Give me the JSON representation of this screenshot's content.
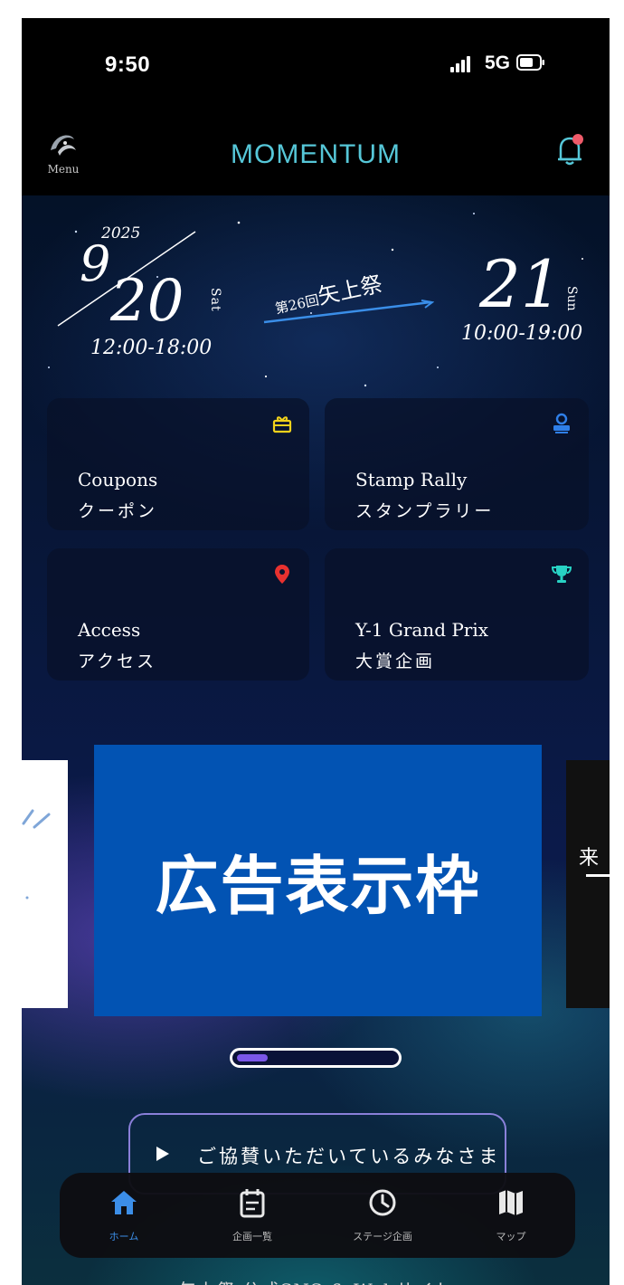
{
  "status_bar": {
    "time": "9:50",
    "network": "5G"
  },
  "header": {
    "menu_label": "Menu",
    "brand": "MOMENTUM"
  },
  "festival": {
    "year": "2025",
    "month": "9",
    "day1": "20",
    "weekday1": "Sat",
    "hours1": "12:00-18:00",
    "edition": "第26回",
    "name": "矢上祭",
    "day2": "21",
    "weekday2": "Sun",
    "hours2": "10:00-19:00"
  },
  "tiles": [
    {
      "en": "Coupons",
      "ja": "クーポン",
      "icon": "gift-icon",
      "color": "#f2d21b"
    },
    {
      "en": "Stamp Rally",
      "ja": "スタンプラリー",
      "icon": "stamp-icon",
      "color": "#2f7fe8"
    },
    {
      "en": "Access",
      "ja": "アクセス",
      "icon": "map-pin-icon",
      "color": "#e8312f"
    },
    {
      "en": "Y-1 Grand Prix",
      "ja": "大賞企画",
      "icon": "trophy-icon",
      "color": "#28d2c4"
    }
  ],
  "ad": {
    "text": "広告表示枠",
    "next_peek": "来"
  },
  "carousel": {
    "current_slide": 1
  },
  "sponsor": {
    "label": "ご協賛いただいているみなさま"
  },
  "nav": [
    {
      "label": "ホーム",
      "icon": "home-icon",
      "active": true
    },
    {
      "label": "企画一覧",
      "icon": "calendar-icon",
      "active": false
    },
    {
      "label": "ステージ企画",
      "icon": "clock-icon",
      "active": false
    },
    {
      "label": "マップ",
      "icon": "map-icon",
      "active": false
    }
  ],
  "footer": {
    "sns_link": "矢上祭 公式SNS & Webサイト"
  },
  "colors": {
    "brand": "#56c7d8",
    "active_nav": "#3c8ee8",
    "ad_bg": "#0253b3",
    "bell_dot": "#ef5b6a",
    "pager_fill": "#7b57e8"
  }
}
